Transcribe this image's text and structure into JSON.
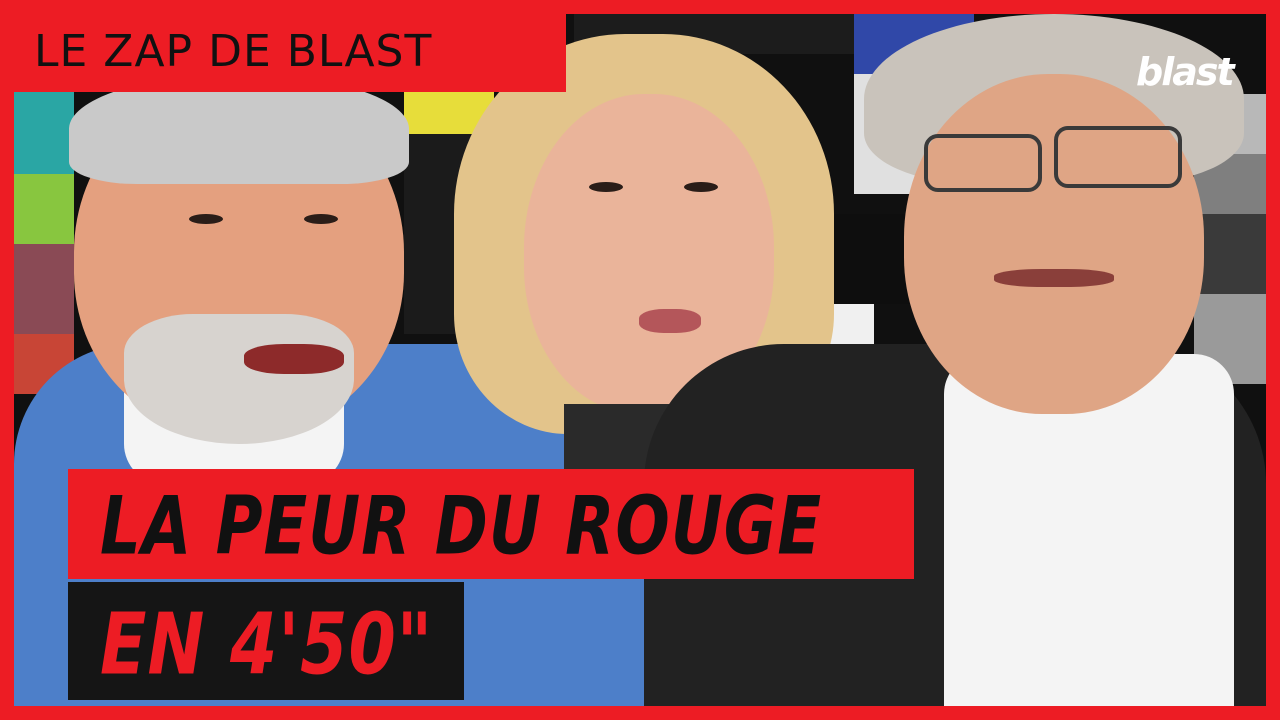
{
  "thumbnail": {
    "series_title": "LE ZAP DE BLAST",
    "logo_text": "blast",
    "headline_line1": "LA PEUR DU ROUGE",
    "headline_line2": "EN 4'50\""
  },
  "colors": {
    "brand_red": "#ed1c24",
    "dark": "#151515",
    "text_dark": "#111111"
  },
  "people": [
    {
      "name": "left-man"
    },
    {
      "name": "center-woman"
    },
    {
      "name": "right-man"
    }
  ]
}
